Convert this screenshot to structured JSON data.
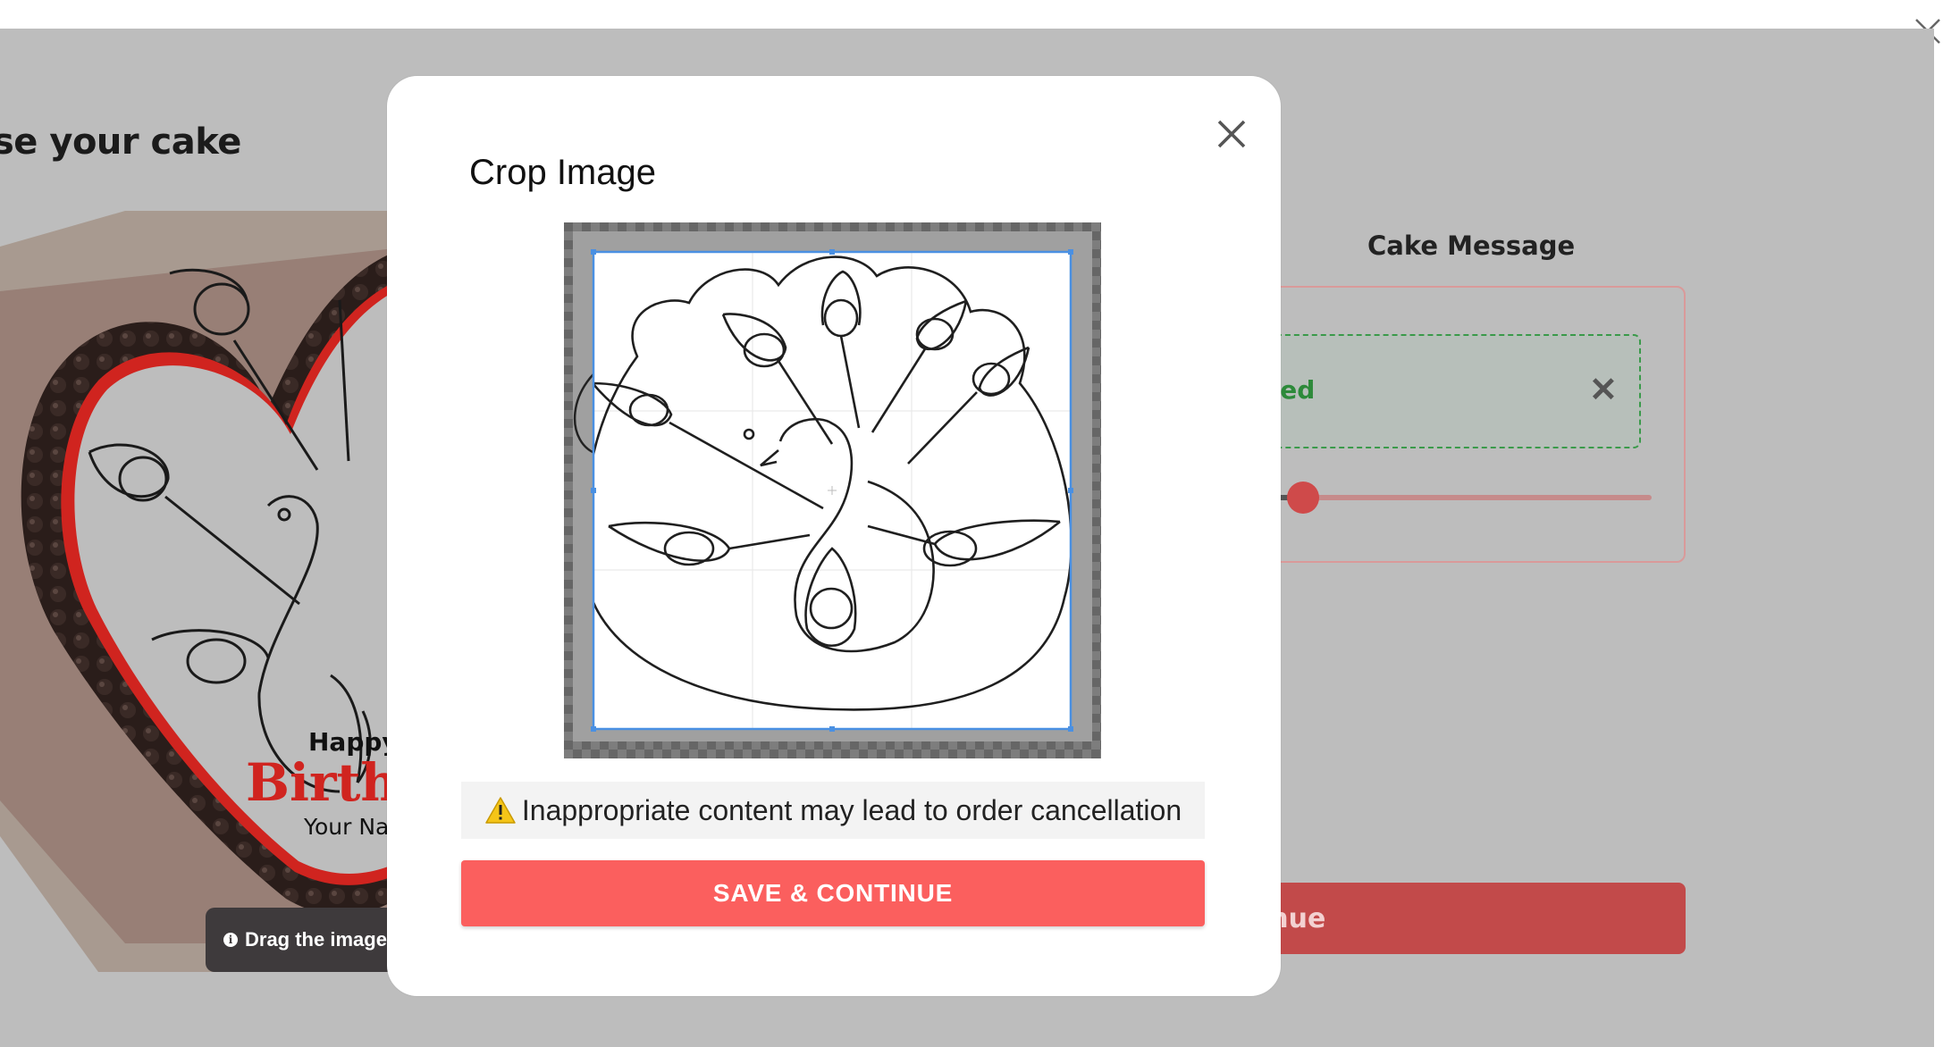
{
  "page": {
    "title_partial": "se your cake"
  },
  "preview": {
    "text_happy": "Happy",
    "text_birthday": "Birth",
    "text_name": "Your Na",
    "drag_hint": "Drag the image"
  },
  "cake_message": {
    "title": "Cake Message",
    "saved_text": "ved",
    "remove_icon": "close-x-icon",
    "slider_value": 0.02
  },
  "background_button": {
    "label": "inue"
  },
  "modal": {
    "title": "Crop Image",
    "close_icon": "close-icon",
    "warning_icon": "warning-icon",
    "warning_text": "Inappropriate content may lead to order cancellation",
    "save_label": "SAVE & CONTINUE"
  },
  "colors": {
    "accent": "#fb5f5e",
    "crop_border": "#4a90e2",
    "success": "#2d8a3a"
  }
}
